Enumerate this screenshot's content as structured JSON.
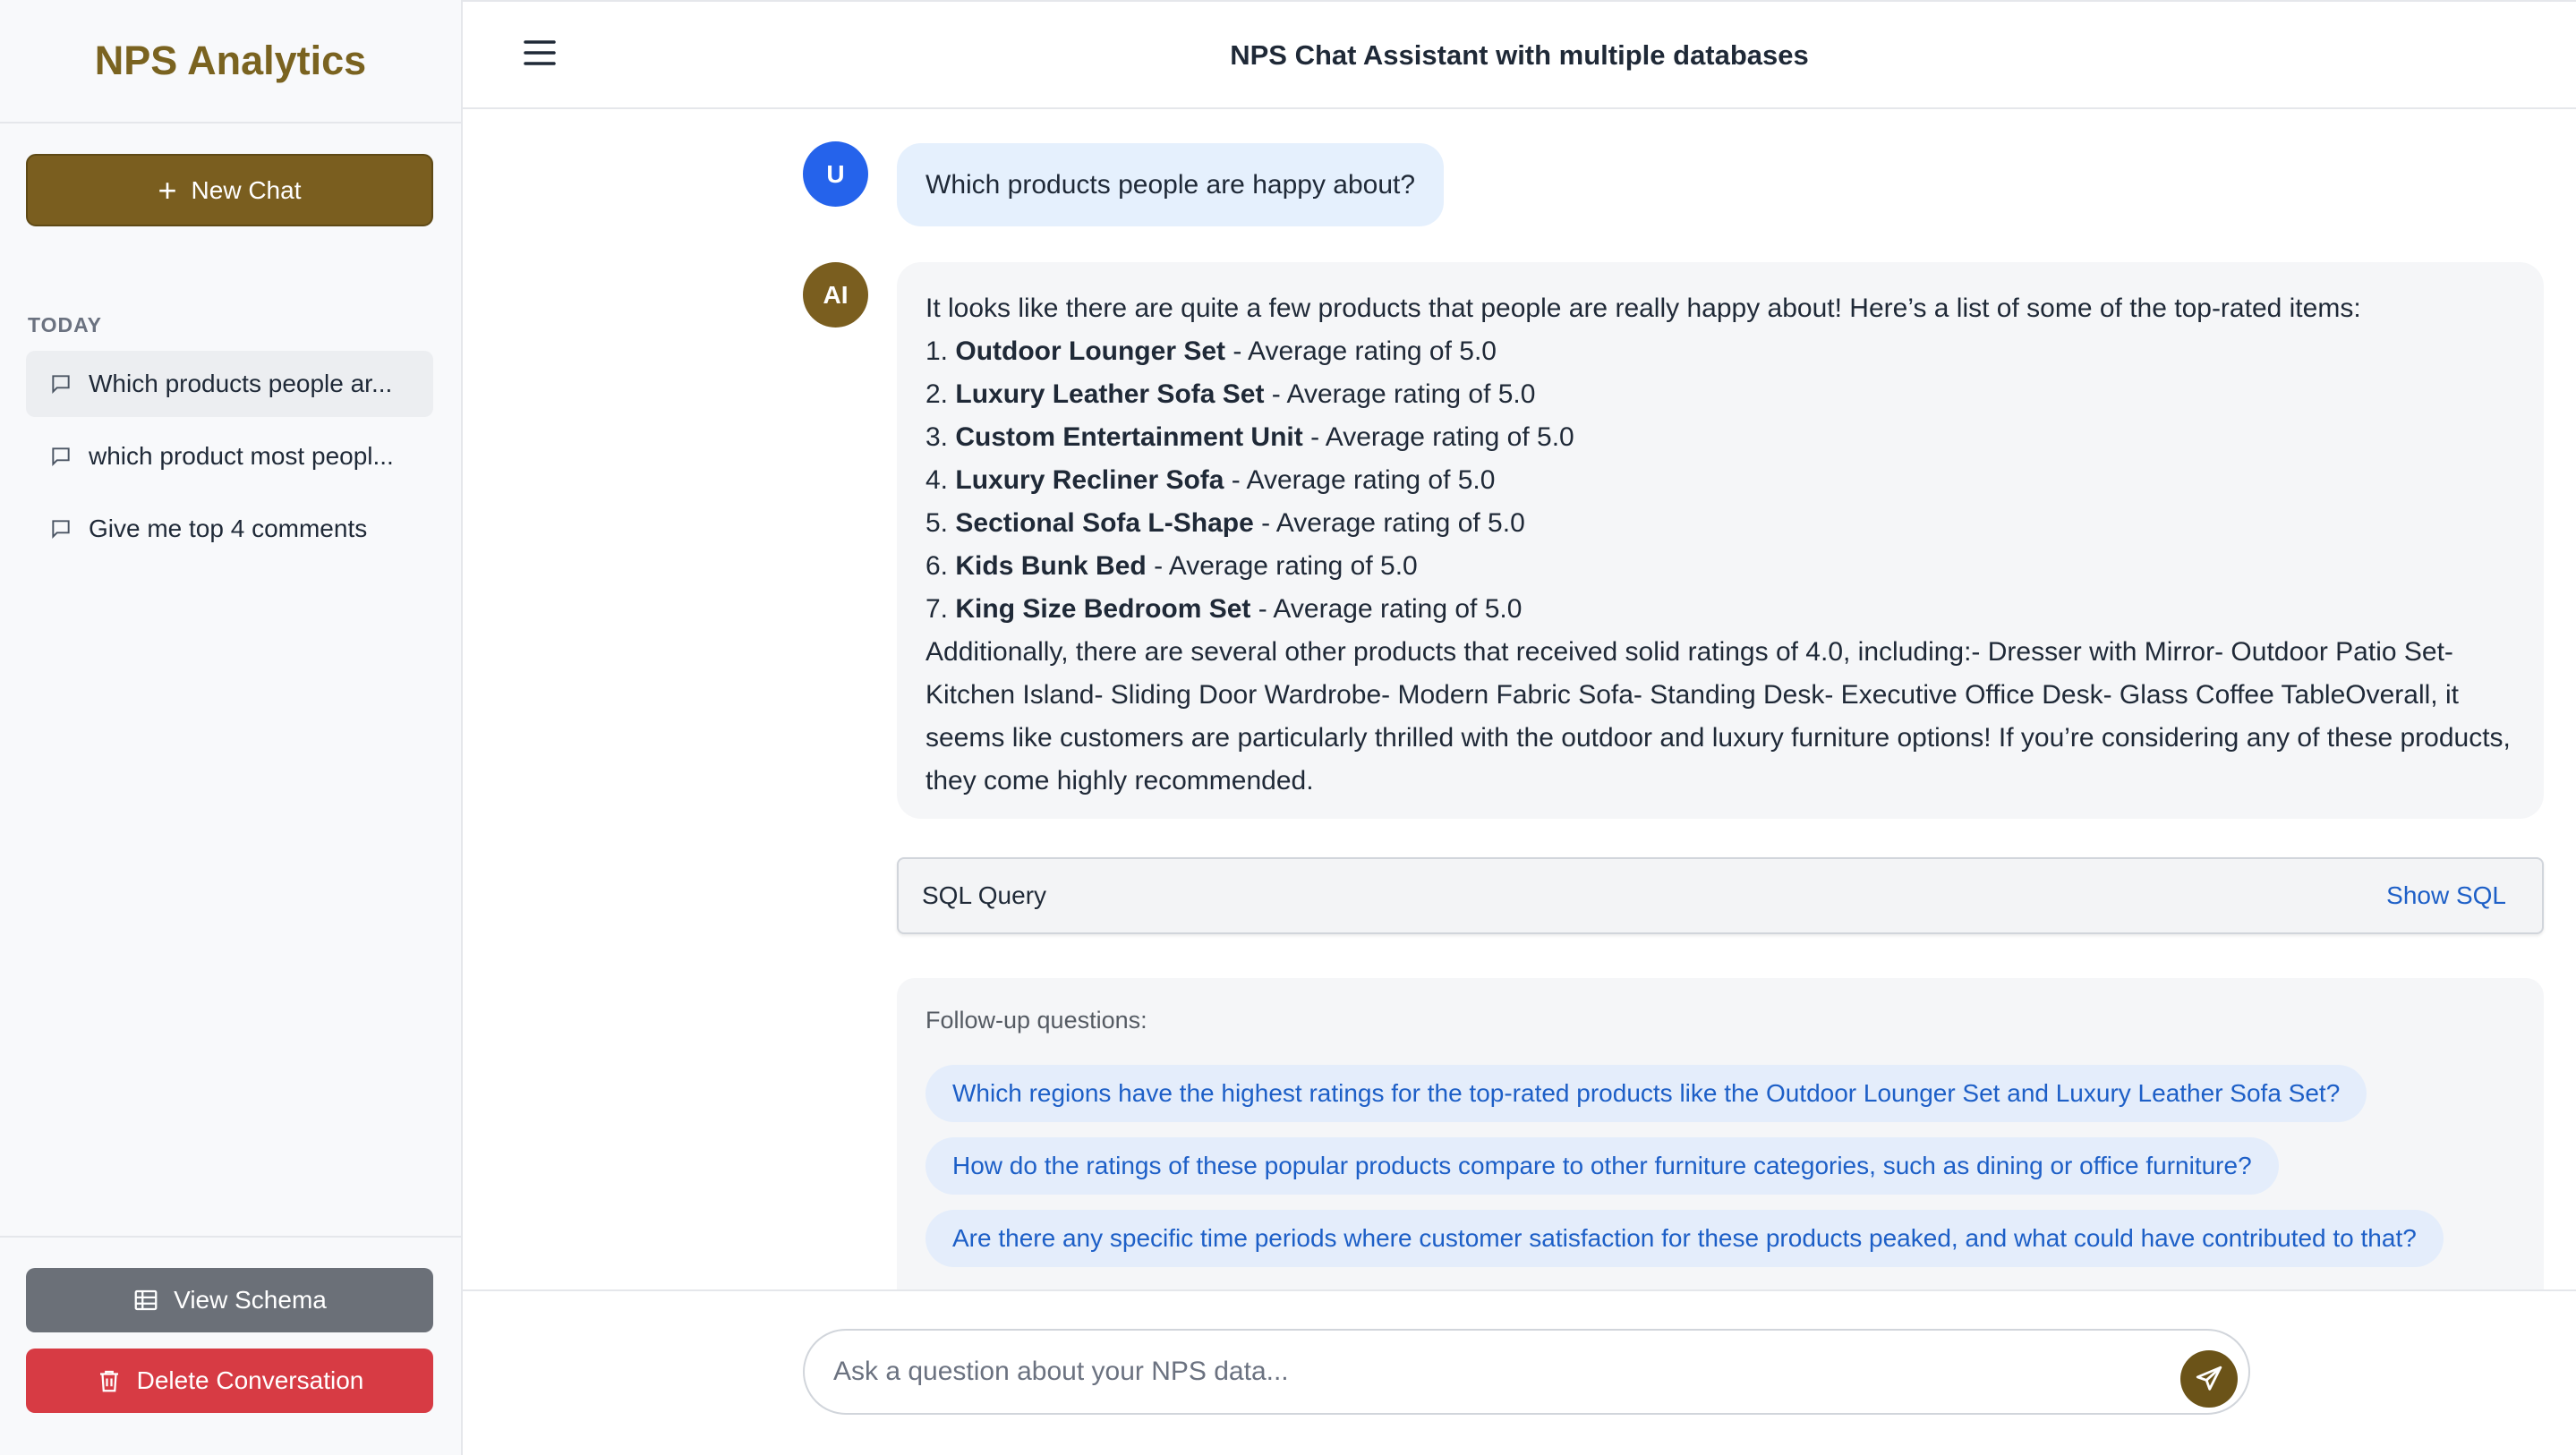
{
  "sidebar": {
    "brand": "NPS Analytics",
    "new_chat_label": "New Chat",
    "section_label": "TODAY",
    "history": [
      {
        "label": "Which products people ar...",
        "active": true
      },
      {
        "label": "which product most peopl...",
        "active": false
      },
      {
        "label": "Give me top 4 comments",
        "active": false
      }
    ],
    "view_schema_label": "View Schema",
    "delete_label": "Delete Conversation"
  },
  "header": {
    "title": "NPS Chat Assistant with multiple databases",
    "menu_icon": "hamburger-menu-icon"
  },
  "conversation": {
    "user_avatar": "U",
    "ai_avatar": "AI",
    "user_message": "Which products people are happy about?",
    "ai_intro": "It looks like there are quite a few products that people are really happy about! Here’s a list of some of the top-rated items:",
    "ai_items": [
      {
        "num": "1.",
        "name": "Outdoor Lounger Set",
        "rest": " - Average rating of 5.0"
      },
      {
        "num": "2.",
        "name": "Luxury Leather Sofa Set",
        "rest": " - Average rating of 5.0"
      },
      {
        "num": "3.",
        "name": "Custom Entertainment Unit",
        "rest": " - Average rating of 5.0"
      },
      {
        "num": "4.",
        "name": "Luxury Recliner Sofa",
        "rest": " - Average rating of 5.0"
      },
      {
        "num": "5.",
        "name": "Sectional Sofa L-Shape",
        "rest": " - Average rating of 5.0"
      },
      {
        "num": "6.",
        "name": "Kids Bunk Bed",
        "rest": " - Average rating of 5.0"
      },
      {
        "num": "7.",
        "name": "King Size Bedroom Set",
        "rest": " - Average rating of 5.0"
      }
    ],
    "ai_outro": "Additionally, there are several other products that received solid ratings of 4.0, including:- Dresser with Mirror- Outdoor Patio Set- Kitchen Island- Sliding Door Wardrobe- Modern Fabric Sofa- Standing Desk- Executive Office Desk- Glass Coffee TableOverall, it seems like customers are particularly thrilled with the outdoor and luxury furniture options! If you’re considering any of these products, they come highly recommended.",
    "sql": {
      "title": "SQL Query",
      "toggle_label": "Show SQL"
    },
    "followups": {
      "label": "Follow-up questions:",
      "questions": [
        "Which regions have the highest ratings for the top-rated products like the Outdoor Lounger Set and Luxury Leather Sofa Set?",
        "How do the ratings of these popular products compare to other furniture categories, such as dining or office furniture?",
        "Are there any specific time periods where customer satisfaction for these products peaked, and what could have contributed to that?"
      ]
    }
  },
  "input": {
    "placeholder": "Ask a question about your NPS data...",
    "value": "",
    "send_icon": "send-icon"
  },
  "colors": {
    "brand": "#7a6320",
    "primary_button": "#7a5e1f",
    "user_avatar": "#2563eb",
    "danger": "#d73b44",
    "neutral_button": "#6b7078",
    "link": "#1d5fc7"
  }
}
